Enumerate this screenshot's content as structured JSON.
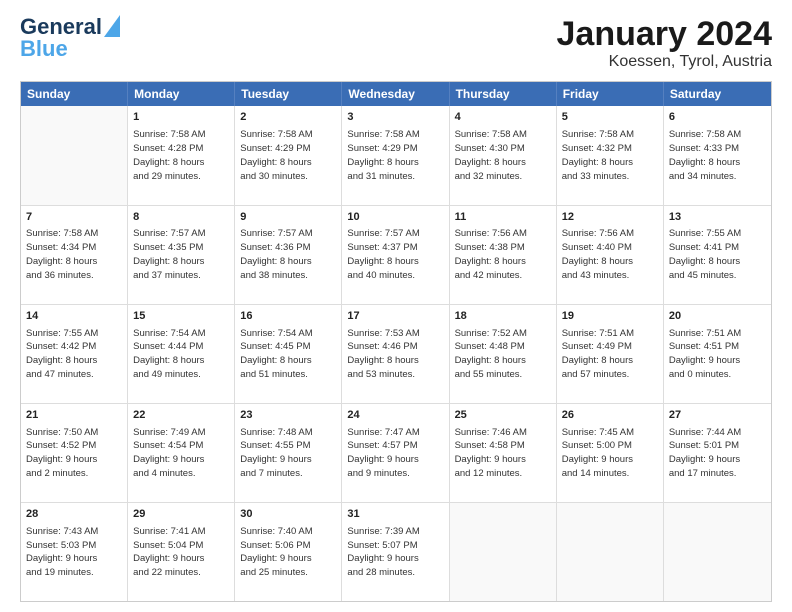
{
  "header": {
    "logo_line1": "General",
    "logo_line2": "Blue",
    "title": "January 2024",
    "subtitle": "Koessen, Tyrol, Austria"
  },
  "calendar": {
    "weekdays": [
      "Sunday",
      "Monday",
      "Tuesday",
      "Wednesday",
      "Thursday",
      "Friday",
      "Saturday"
    ],
    "rows": [
      [
        {
          "day": "",
          "content": "",
          "empty": true
        },
        {
          "day": "1",
          "content": "Sunrise: 7:58 AM\nSunset: 4:28 PM\nDaylight: 8 hours\nand 29 minutes."
        },
        {
          "day": "2",
          "content": "Sunrise: 7:58 AM\nSunset: 4:29 PM\nDaylight: 8 hours\nand 30 minutes."
        },
        {
          "day": "3",
          "content": "Sunrise: 7:58 AM\nSunset: 4:29 PM\nDaylight: 8 hours\nand 31 minutes."
        },
        {
          "day": "4",
          "content": "Sunrise: 7:58 AM\nSunset: 4:30 PM\nDaylight: 8 hours\nand 32 minutes."
        },
        {
          "day": "5",
          "content": "Sunrise: 7:58 AM\nSunset: 4:32 PM\nDaylight: 8 hours\nand 33 minutes."
        },
        {
          "day": "6",
          "content": "Sunrise: 7:58 AM\nSunset: 4:33 PM\nDaylight: 8 hours\nand 34 minutes."
        }
      ],
      [
        {
          "day": "7",
          "content": "Sunrise: 7:58 AM\nSunset: 4:34 PM\nDaylight: 8 hours\nand 36 minutes."
        },
        {
          "day": "8",
          "content": "Sunrise: 7:57 AM\nSunset: 4:35 PM\nDaylight: 8 hours\nand 37 minutes."
        },
        {
          "day": "9",
          "content": "Sunrise: 7:57 AM\nSunset: 4:36 PM\nDaylight: 8 hours\nand 38 minutes."
        },
        {
          "day": "10",
          "content": "Sunrise: 7:57 AM\nSunset: 4:37 PM\nDaylight: 8 hours\nand 40 minutes."
        },
        {
          "day": "11",
          "content": "Sunrise: 7:56 AM\nSunset: 4:38 PM\nDaylight: 8 hours\nand 42 minutes."
        },
        {
          "day": "12",
          "content": "Sunrise: 7:56 AM\nSunset: 4:40 PM\nDaylight: 8 hours\nand 43 minutes."
        },
        {
          "day": "13",
          "content": "Sunrise: 7:55 AM\nSunset: 4:41 PM\nDaylight: 8 hours\nand 45 minutes."
        }
      ],
      [
        {
          "day": "14",
          "content": "Sunrise: 7:55 AM\nSunset: 4:42 PM\nDaylight: 8 hours\nand 47 minutes."
        },
        {
          "day": "15",
          "content": "Sunrise: 7:54 AM\nSunset: 4:44 PM\nDaylight: 8 hours\nand 49 minutes."
        },
        {
          "day": "16",
          "content": "Sunrise: 7:54 AM\nSunset: 4:45 PM\nDaylight: 8 hours\nand 51 minutes."
        },
        {
          "day": "17",
          "content": "Sunrise: 7:53 AM\nSunset: 4:46 PM\nDaylight: 8 hours\nand 53 minutes."
        },
        {
          "day": "18",
          "content": "Sunrise: 7:52 AM\nSunset: 4:48 PM\nDaylight: 8 hours\nand 55 minutes."
        },
        {
          "day": "19",
          "content": "Sunrise: 7:51 AM\nSunset: 4:49 PM\nDaylight: 8 hours\nand 57 minutes."
        },
        {
          "day": "20",
          "content": "Sunrise: 7:51 AM\nSunset: 4:51 PM\nDaylight: 9 hours\nand 0 minutes."
        }
      ],
      [
        {
          "day": "21",
          "content": "Sunrise: 7:50 AM\nSunset: 4:52 PM\nDaylight: 9 hours\nand 2 minutes."
        },
        {
          "day": "22",
          "content": "Sunrise: 7:49 AM\nSunset: 4:54 PM\nDaylight: 9 hours\nand 4 minutes."
        },
        {
          "day": "23",
          "content": "Sunrise: 7:48 AM\nSunset: 4:55 PM\nDaylight: 9 hours\nand 7 minutes."
        },
        {
          "day": "24",
          "content": "Sunrise: 7:47 AM\nSunset: 4:57 PM\nDaylight: 9 hours\nand 9 minutes."
        },
        {
          "day": "25",
          "content": "Sunrise: 7:46 AM\nSunset: 4:58 PM\nDaylight: 9 hours\nand 12 minutes."
        },
        {
          "day": "26",
          "content": "Sunrise: 7:45 AM\nSunset: 5:00 PM\nDaylight: 9 hours\nand 14 minutes."
        },
        {
          "day": "27",
          "content": "Sunrise: 7:44 AM\nSunset: 5:01 PM\nDaylight: 9 hours\nand 17 minutes."
        }
      ],
      [
        {
          "day": "28",
          "content": "Sunrise: 7:43 AM\nSunset: 5:03 PM\nDaylight: 9 hours\nand 19 minutes."
        },
        {
          "day": "29",
          "content": "Sunrise: 7:41 AM\nSunset: 5:04 PM\nDaylight: 9 hours\nand 22 minutes."
        },
        {
          "day": "30",
          "content": "Sunrise: 7:40 AM\nSunset: 5:06 PM\nDaylight: 9 hours\nand 25 minutes."
        },
        {
          "day": "31",
          "content": "Sunrise: 7:39 AM\nSunset: 5:07 PM\nDaylight: 9 hours\nand 28 minutes."
        },
        {
          "day": "",
          "content": "",
          "empty": true
        },
        {
          "day": "",
          "content": "",
          "empty": true
        },
        {
          "day": "",
          "content": "",
          "empty": true
        }
      ]
    ]
  }
}
